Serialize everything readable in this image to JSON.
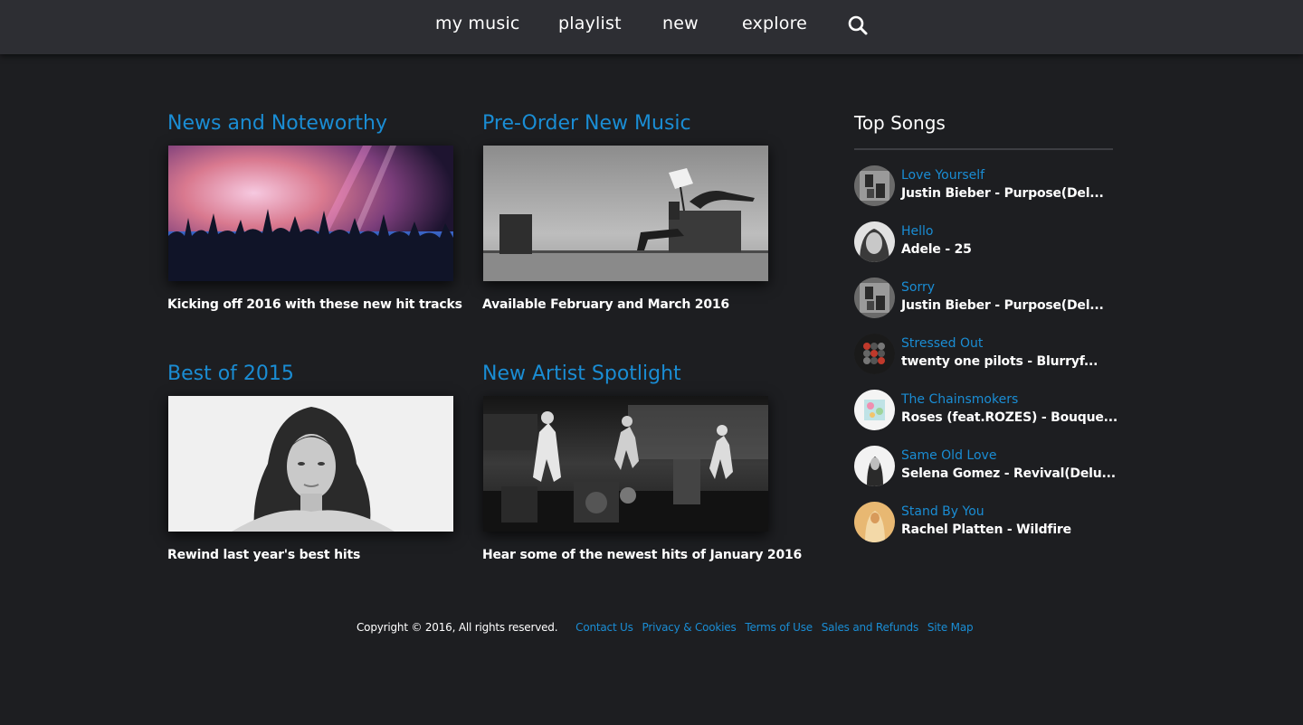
{
  "nav": {
    "items": [
      "my music",
      "playlist",
      "new",
      "explore"
    ],
    "search_icon": "search-icon"
  },
  "cards": [
    {
      "title": "News and Noteworthy",
      "caption": "Kicking off 2016 with these new hit tracks"
    },
    {
      "title": "Pre-Order New Music",
      "caption": "Available February and March 2016"
    },
    {
      "title": "Best of 2015",
      "caption": "Rewind last year's best hits"
    },
    {
      "title": "New Artist Spotlight",
      "caption": "Hear some of the newest hits of January 2016"
    }
  ],
  "top_songs": {
    "title": "Top Songs",
    "items": [
      {
        "title": "Love Yourself",
        "subtitle": "Justin Bieber - Purpose(Del..."
      },
      {
        "title": "Hello",
        "subtitle": "Adele - 25"
      },
      {
        "title": "Sorry",
        "subtitle": "Justin Bieber - Purpose(Del..."
      },
      {
        "title": "Stressed Out",
        "subtitle": "twenty one pilots - Blurryf..."
      },
      {
        "title": "The Chainsmokers",
        "subtitle": "Roses (feat.ROZES) - Bouque..."
      },
      {
        "title": "Same Old Love",
        "subtitle": "Selena Gomez - Revival(Delu..."
      },
      {
        "title": "Stand By You",
        "subtitle": "Rachel Platten - Wildfire"
      }
    ]
  },
  "footer": {
    "copyright": "Copyright © 2016, All rights reserved.",
    "links": [
      "Contact Us",
      "Privacy & Cookies",
      "Terms of Use",
      "Sales and Refunds",
      "Site Map"
    ]
  },
  "colors": {
    "background": "#1d1e21",
    "nav_background": "#2d2e33",
    "accent": "#1a8dd4",
    "text": "#ffffff"
  }
}
